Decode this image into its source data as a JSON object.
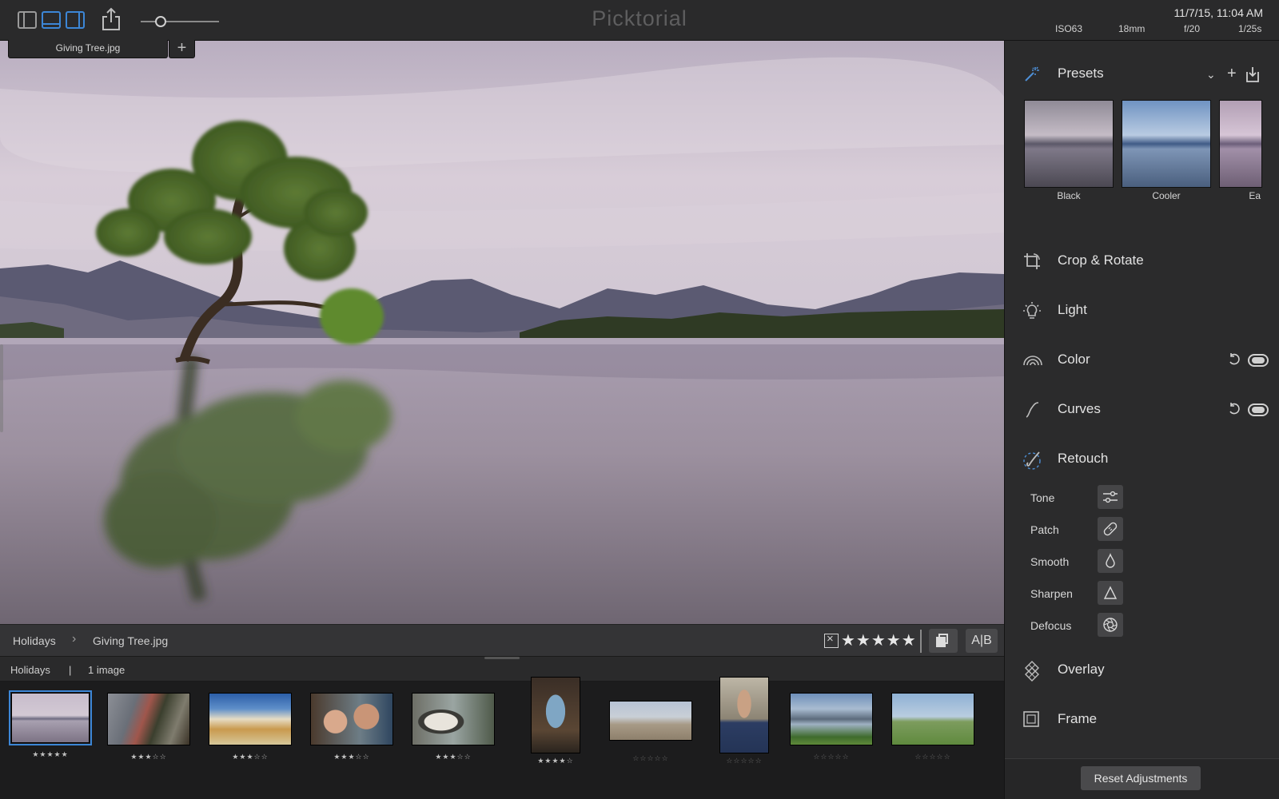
{
  "app": {
    "title": "Picktorial"
  },
  "metadata": {
    "datetime": "11/7/15, 11:04 AM",
    "iso": "ISO63",
    "focal_length": "18mm",
    "aperture": "f/20",
    "shutter": "1/25s"
  },
  "tabs": {
    "active": "Giving Tree.jpg",
    "add_label": "+"
  },
  "zoom": {
    "level": 0.25
  },
  "info_bar": {
    "breadcrumb_album": "Holidays",
    "breadcrumb_sep": "›",
    "breadcrumb_file": "Giving Tree.jpg",
    "rating": 5,
    "rating_text": "★★★★★",
    "ab_label": "A|B"
  },
  "strip": {
    "album": "Holidays",
    "divider": "|",
    "count": "1 image",
    "thumbnails": [
      {
        "name": "lake-tree",
        "stars": "★★★★★",
        "rating": 5,
        "selected": true
      },
      {
        "name": "couple-bikes",
        "stars": "★★★☆☆",
        "rating": 3
      },
      {
        "name": "beach-clouds",
        "stars": "★★★☆☆",
        "rating": 3
      },
      {
        "name": "couple-selfie",
        "stars": "★★★☆☆",
        "rating": 3
      },
      {
        "name": "lemur",
        "stars": "★★★☆☆",
        "rating": 3
      },
      {
        "name": "crowned-pigeon",
        "stars": "★★★★☆",
        "rating": 4
      },
      {
        "name": "desert-plain",
        "stars": "☆☆☆☆☆",
        "rating": 0
      },
      {
        "name": "old-man",
        "stars": "☆☆☆☆☆",
        "rating": 0
      },
      {
        "name": "lake-reflection",
        "stars": "☆☆☆☆☆",
        "rating": 0
      },
      {
        "name": "green-field",
        "stars": "☆☆☆☆☆",
        "rating": 0
      }
    ]
  },
  "panel": {
    "presets": {
      "label": "Presets",
      "items": [
        {
          "label": "Black"
        },
        {
          "label": "Cooler"
        },
        {
          "label": "Ea"
        }
      ]
    },
    "sections": {
      "crop": "Crop & Rotate",
      "light": "Light",
      "color": "Color",
      "curves": "Curves",
      "retouch": "Retouch",
      "overlay": "Overlay",
      "frame": "Frame"
    },
    "retouch_tools": {
      "tone": "Tone",
      "patch": "Patch",
      "smooth": "Smooth",
      "sharpen": "Sharpen",
      "defocus": "Defocus"
    },
    "reset_label": "Reset Adjustments"
  },
  "colors": {
    "accent": "#3c86d6",
    "bg": "#2b2b2c"
  }
}
